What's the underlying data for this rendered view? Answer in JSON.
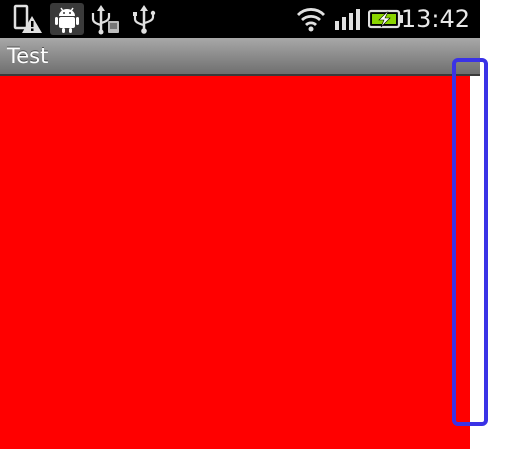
{
  "status_bar": {
    "time": "13:42",
    "icons": [
      "alert-icon",
      "android-debug-icon",
      "usb-storage-icon",
      "usb-icon",
      "wifi-icon",
      "signal-icon",
      "battery-charging-icon"
    ]
  },
  "app": {
    "title": "Test"
  },
  "colors": {
    "content_view": "#ff0000",
    "highlight": "#3a32e6",
    "status_bar_bg": "#000000"
  }
}
